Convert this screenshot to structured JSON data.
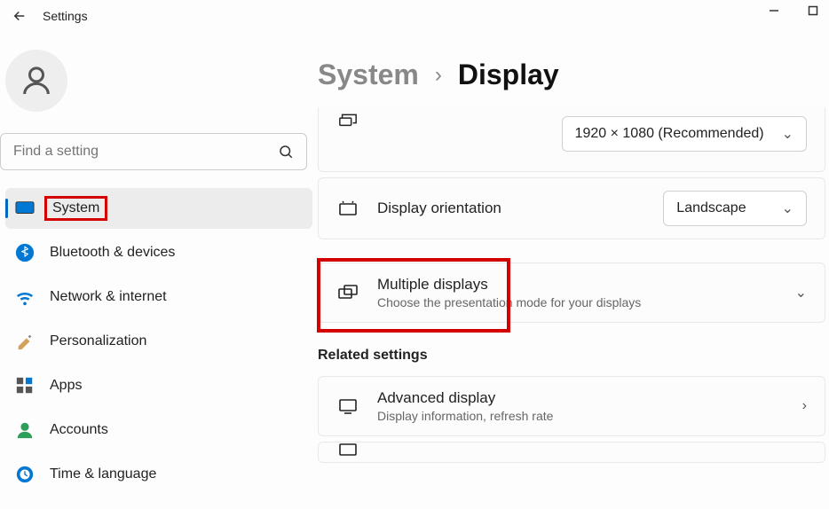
{
  "titlebar": {
    "title": "Settings"
  },
  "search": {
    "placeholder": "Find a setting"
  },
  "nav": {
    "items": [
      {
        "label": "System"
      },
      {
        "label": "Bluetooth & devices"
      },
      {
        "label": "Network & internet"
      },
      {
        "label": "Personalization"
      },
      {
        "label": "Apps"
      },
      {
        "label": "Accounts"
      },
      {
        "label": "Time & language"
      }
    ]
  },
  "breadcrumb": {
    "parent": "System",
    "current": "Display"
  },
  "settings": {
    "resolution_value": "1920 × 1080 (Recommended)",
    "orientation": {
      "title": "Display orientation",
      "value": "Landscape"
    },
    "multiple": {
      "title": "Multiple displays",
      "sub": "Choose the presentation mode for your displays"
    },
    "related_heading": "Related settings",
    "advanced": {
      "title": "Advanced display",
      "sub": "Display information, refresh rate"
    }
  }
}
